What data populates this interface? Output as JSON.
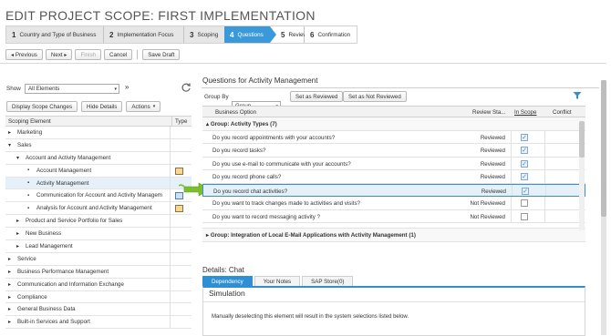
{
  "page": {
    "title": "EDIT PROJECT SCOPE: FIRST IMPLEMENTATION"
  },
  "steps": [
    {
      "num": "1",
      "label": "Country and Type of Business"
    },
    {
      "num": "2",
      "label": "Implementation Focus"
    },
    {
      "num": "3",
      "label": "Scoping"
    },
    {
      "num": "4",
      "label": "Questions"
    },
    {
      "num": "5",
      "label": "Review"
    },
    {
      "num": "6",
      "label": "Confirmation"
    }
  ],
  "toolbar": {
    "previous": "◂ Previous",
    "next": "Next ▸",
    "finish": "Finish",
    "cancel": "Cancel",
    "save_draft": "Save Draft"
  },
  "left": {
    "show_label": "Show",
    "show_value": "All Elements",
    "collapse_glyph": "»",
    "display_scope_changes": "Display Scope Changes",
    "hide_details": "Hide Details",
    "actions": "Actions",
    "col_scoping": "Scoping Element",
    "col_type": "Type",
    "tree": [
      {
        "label": "Marketing",
        "arrow": "▸"
      },
      {
        "label": "Sales",
        "arrow": "▾"
      },
      {
        "label": "Account and Activity Management",
        "arrow": "▾"
      },
      {
        "label": "Account Management",
        "arrow": "▪"
      },
      {
        "label": "Activity Management",
        "arrow": "▪"
      },
      {
        "label": "Communication for Account and Activity Managem",
        "arrow": "▪"
      },
      {
        "label": "Analysis for Account and Activity Management",
        "arrow": "▪"
      },
      {
        "label": "Product and Service Portfolio for Sales",
        "arrow": "▸"
      },
      {
        "label": "New Business",
        "arrow": "▸"
      },
      {
        "label": "Lead Management",
        "arrow": "▸"
      },
      {
        "label": "Service",
        "arrow": "▸"
      },
      {
        "label": "Business Performance Management",
        "arrow": "▸"
      },
      {
        "label": "Communication and Information Exchange",
        "arrow": "▸"
      },
      {
        "label": "Compliance",
        "arrow": "▸"
      },
      {
        "label": "General Business Data",
        "arrow": "▸"
      },
      {
        "label": "Built-in Services and Support",
        "arrow": "▸"
      }
    ]
  },
  "right": {
    "title": "Questions for Activity Management",
    "group_by_label": "Group By",
    "group_by_value": "Group",
    "set_reviewed": "Set as Reviewed",
    "set_not_reviewed": "Set as Not Reviewed",
    "col_option": "Business Option",
    "col_review": "Review Sta...",
    "col_in_scope": "In Scope",
    "col_conflict": "Conflict",
    "group1": "Group: Activity Types (7)",
    "rows": [
      {
        "q": "Do you record appointments with your accounts?",
        "status": "Reviewed",
        "in_scope": "✓"
      },
      {
        "q": "Do you record tasks?",
        "status": "Reviewed",
        "in_scope": "✓"
      },
      {
        "q": "Do you use e-mail to communicate with your accounts?",
        "status": "Reviewed",
        "in_scope": "✓"
      },
      {
        "q": "Do you record phone calls?",
        "status": "Reviewed",
        "in_scope": "✓"
      },
      {
        "q": "Do you record chat activities?",
        "status": "Reviewed",
        "in_scope": "✓"
      },
      {
        "q": "Do you want to track changes made to activities and visits?",
        "status": "Not Reviewed",
        "in_scope": ""
      },
      {
        "q": "Do you want to record messaging activity ?",
        "status": "Not Reviewed",
        "in_scope": ""
      }
    ],
    "group2": "Group: Integration of Local E-Mail Applications with Activity Management (1)"
  },
  "details": {
    "title": "Details: Chat",
    "tabs": [
      "Dependency",
      "Your Notes",
      "SAP Store(0)"
    ],
    "simulation_title": "Simulation",
    "simulation_text": "Manually deselecting this element will result in the system selections listed below."
  }
}
